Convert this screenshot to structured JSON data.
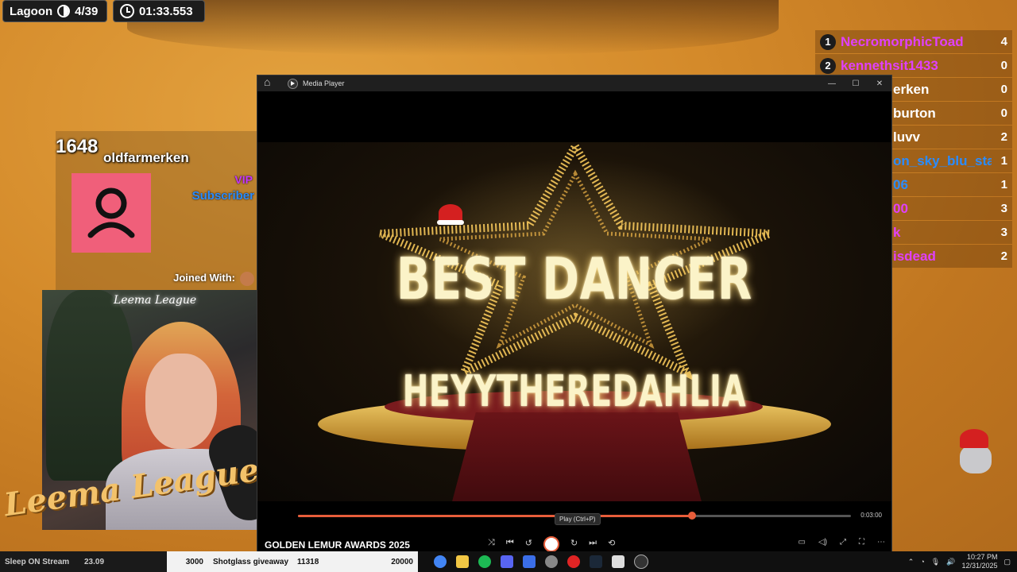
{
  "hud": {
    "game_label": "Lagoon",
    "progress": "4/39",
    "timer": "01:33.553"
  },
  "leaderboard": [
    {
      "rank": "1",
      "name": "NecromorphicToad",
      "score": "4",
      "color": "#e040fb"
    },
    {
      "rank": "2",
      "name": "kennethsit1433",
      "score": "0",
      "color": "#e040fb"
    },
    {
      "rank": "",
      "name": "erken",
      "score": "0",
      "color": "#ffffff"
    },
    {
      "rank": "",
      "name": "burton",
      "score": "0",
      "color": "#ffffff"
    },
    {
      "rank": "",
      "name": "luvv",
      "score": "2",
      "color": "#ffffff"
    },
    {
      "rank": "",
      "name": "on_sky_blu_star",
      "score": "1",
      "color": "#2a8cff"
    },
    {
      "rank": "",
      "name": "06",
      "score": "1",
      "color": "#2a8cff"
    },
    {
      "rank": "",
      "name": "00",
      "score": "3",
      "color": "#e040fb"
    },
    {
      "rank": "",
      "name": "k",
      "score": "3",
      "color": "#e040fb"
    },
    {
      "rank": "",
      "name": "isdead",
      "score": "2",
      "color": "#e040fb"
    }
  ],
  "subscriber": {
    "count": "1648",
    "name": "oldfarmerken",
    "role": "VIP",
    "tier": "Subscriber",
    "joined_label": "Joined With:"
  },
  "webcam": {
    "neon_sign": "Leema League",
    "logo": "Leema League"
  },
  "media_player": {
    "title": "Media Player",
    "video_line1": "BEST DANCER",
    "video_line2": "HEYYTHEREDAHLIA",
    "progress_fraction": 0.712,
    "duration": "0:03:00",
    "tooltip": "Play (Ctrl+P)",
    "now_playing": "GOLDEN LEMUR AWARDS 2025",
    "accent": "#e85d3a"
  },
  "bottom_bar": {
    "ticker": "Sleep ON Stream",
    "ticker_value": "23.09",
    "goal_a": "3000",
    "giveaway": "Shotglass giveaway",
    "giveaway_value": "11318",
    "goal_b": "20000"
  },
  "taskbar": {
    "time": "10:27 PM",
    "date": "12/31/2025"
  }
}
